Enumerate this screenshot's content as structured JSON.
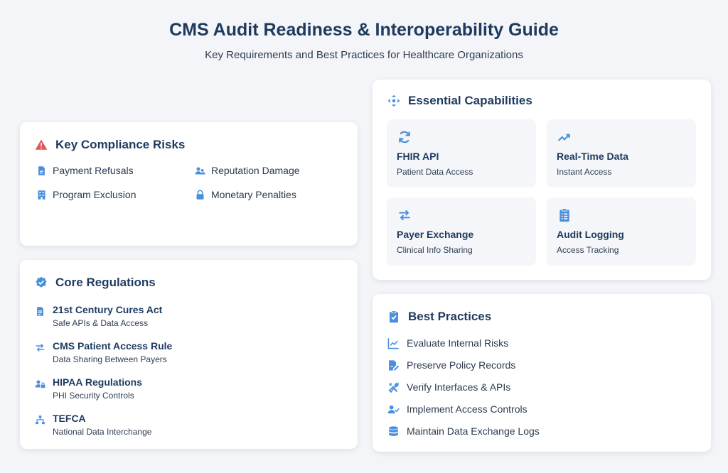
{
  "header": {
    "title": "CMS Audit Readiness & Interoperability Guide",
    "subtitle": "Key Requirements and Best Practices for Healthcare Organizations"
  },
  "risks": {
    "heading": "Key Compliance Risks",
    "icon": "warning-icon",
    "items": [
      {
        "label": "Payment Refusals",
        "icon": "file-invoice-icon"
      },
      {
        "label": "Reputation Damage",
        "icon": "users-icon"
      },
      {
        "label": "Program Exclusion",
        "icon": "building-icon"
      },
      {
        "label": "Monetary Penalties",
        "icon": "lock-icon"
      }
    ]
  },
  "regulations": {
    "heading": "Core Regulations",
    "icon": "verified-badge-icon",
    "items": [
      {
        "title": "21st Century Cures Act",
        "sub": "Safe APIs & Data Access",
        "icon": "document-icon"
      },
      {
        "title": "CMS Patient Access Rule",
        "sub": "Data Sharing Between Payers",
        "icon": "exchange-arrows-icon"
      },
      {
        "title": "HIPAA Regulations",
        "sub": "PHI Security Controls",
        "icon": "user-lock-icon"
      },
      {
        "title": "TEFCA",
        "sub": "National Data Interchange",
        "icon": "network-icon"
      }
    ]
  },
  "capabilities": {
    "heading": "Essential Capabilities",
    "icon": "arrows-move-icon",
    "items": [
      {
        "title": "FHIR API",
        "sub": "Patient Data Access",
        "icon": "sync-icon"
      },
      {
        "title": "Real-Time Data",
        "sub": "Instant Access",
        "icon": "trend-line-icon"
      },
      {
        "title": "Payer Exchange",
        "sub": "Clinical Info Sharing",
        "icon": "exchange-arrows-icon"
      },
      {
        "title": "Audit Logging",
        "sub": "Access Tracking",
        "icon": "clipboard-list-icon"
      }
    ]
  },
  "practices": {
    "heading": "Best Practices",
    "icon": "clipboard-check-icon",
    "items": [
      {
        "label": "Evaluate Internal Risks",
        "icon": "chart-line-icon"
      },
      {
        "label": "Preserve Policy Records",
        "icon": "file-signature-icon"
      },
      {
        "label": "Verify Interfaces & APIs",
        "icon": "tools-icon"
      },
      {
        "label": "Implement Access Controls",
        "icon": "user-check-icon"
      },
      {
        "label": "Maintain Data Exchange Logs",
        "icon": "database-icon"
      }
    ]
  },
  "colors": {
    "accent": "#4a8fdc",
    "danger": "#e05555",
    "heading": "#1e3a5f",
    "background": "#f3f5f8",
    "tile": "#f4f6f9"
  }
}
